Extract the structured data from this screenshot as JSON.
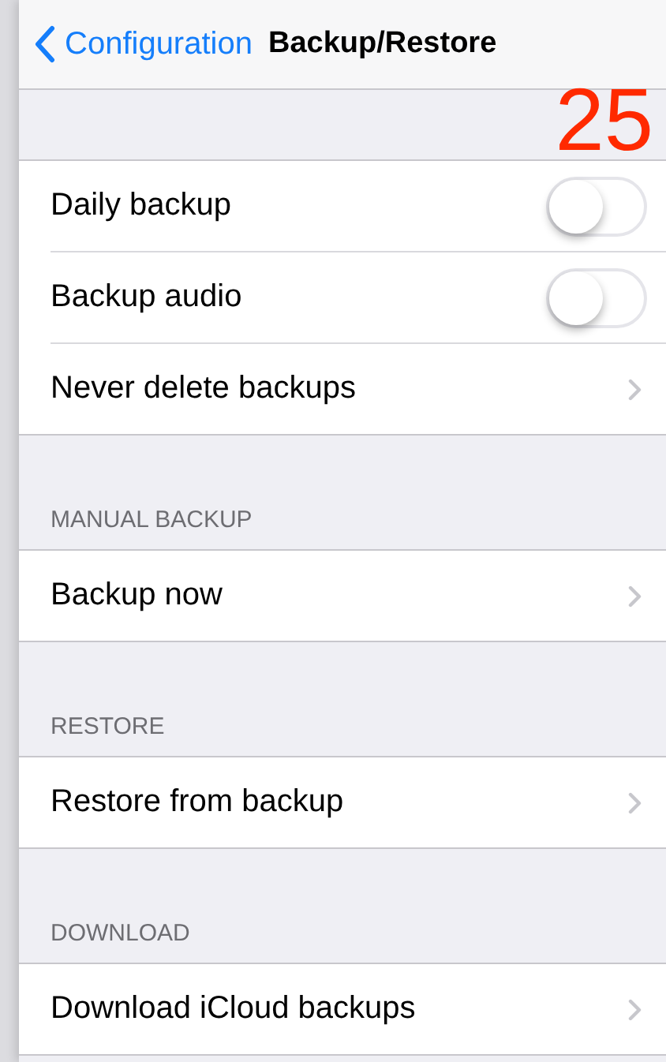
{
  "nav": {
    "back_label": "Configuration",
    "title": "Backup/Restore"
  },
  "overlay_number": "25",
  "sections": [
    {
      "rows": [
        {
          "label": "Daily backup",
          "kind": "toggle",
          "on": false
        },
        {
          "label": "Backup audio",
          "kind": "toggle",
          "on": false
        },
        {
          "label": "Never delete backups",
          "kind": "disclosure"
        }
      ]
    },
    {
      "header": "MANUAL BACKUP",
      "rows": [
        {
          "label": "Backup now",
          "kind": "disclosure"
        }
      ]
    },
    {
      "header": "RESTORE",
      "rows": [
        {
          "label": "Restore from backup",
          "kind": "disclosure"
        }
      ]
    },
    {
      "header": "DOWNLOAD",
      "rows": [
        {
          "label": "Download iCloud backups",
          "kind": "disclosure"
        }
      ]
    }
  ]
}
